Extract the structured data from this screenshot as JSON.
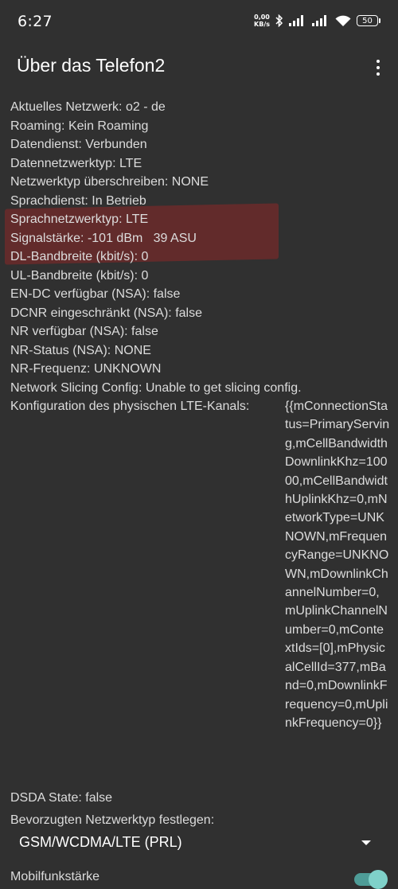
{
  "status_bar": {
    "time": "6:27",
    "net_speed_value": "0,00",
    "net_speed_unit": "KB/s",
    "battery": "50"
  },
  "app_bar": {
    "title": "Über das Telefon2"
  },
  "info_rows": [
    {
      "key": "Aktuelles Netzwerk:",
      "value": "o2 - de"
    },
    {
      "key": "Roaming:",
      "value": "Kein Roaming"
    },
    {
      "key": "Datendienst:",
      "value": "Verbunden"
    },
    {
      "key": "Datennetzwerktyp:",
      "value": "LTE"
    },
    {
      "key": "Netzwerktyp überschreiben:",
      "value": "NONE"
    },
    {
      "key": "Sprachdienst:",
      "value": "In Betrieb"
    },
    {
      "key": "Sprachnetzwerktyp:",
      "value": "LTE"
    },
    {
      "key": "Signalstärke:",
      "value": "-101 dBm   39 ASU"
    },
    {
      "key": "DL-Bandbreite (kbit/s):",
      "value": "0"
    },
    {
      "key": "UL-Bandbreite (kbit/s):",
      "value": "0"
    },
    {
      "key": "EN-DC verfügbar (NSA):",
      "value": "false"
    },
    {
      "key": "DCNR eingeschränkt (NSA):",
      "value": "false"
    },
    {
      "key": "NR verfügbar (NSA):",
      "value": "false"
    },
    {
      "key": "NR-Status (NSA):",
      "value": "NONE"
    },
    {
      "key": "NR-Frequenz:",
      "value": "UNKNOWN"
    },
    {
      "key": "Network Slicing Config:",
      "value": "Unable to get slicing config."
    }
  ],
  "lte_channel": {
    "key": "Konfiguration des physischen LTE-Kanals:",
    "value": "{{mConnectionStatus=PrimaryServing,mCellBandwidthDownlinkKhz=10000,mCellBandwidthUplinkKhz=0,mNetworkType=UNKNOWN,mFrequencyRange=UNKNOWN,mDownlinkChannelNumber=0,mUplinkChannelNumber=0,mContextIds=[0],mPhysicalCellId=377,mBand=0,mDownlinkFrequency=0,mUplinkFrequency=0}}"
  },
  "dsda": {
    "key": "DSDA State:",
    "value": "false"
  },
  "preferred_network": {
    "label": "Bevorzugten Netzwerktyp festlegen:",
    "selected": "GSM/WCDMA/LTE (PRL)"
  },
  "mobile_signal": {
    "label": "Mobilfunkstärke",
    "enabled": true
  },
  "colors": {
    "background": "#303030",
    "highlight": "#8c2828",
    "toggle_accent": "#7fd1c9"
  }
}
